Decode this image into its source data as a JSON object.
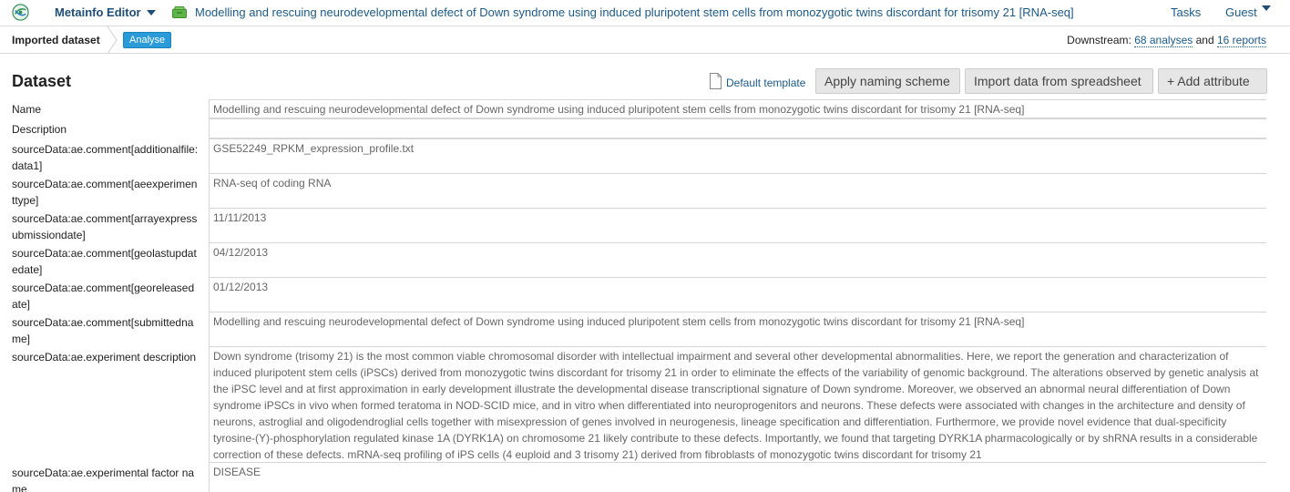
{
  "topbar": {
    "app_title": "Metainfo Editor",
    "dataset_title": "Modelling and rescuing neurodevelopmental defect of Down syndrome using induced pluripotent stem cells from monozygotic twins discordant for trisomy 21 [RNA-seq]",
    "tasks_label": "Tasks",
    "user_label": "Guest"
  },
  "subbar": {
    "breadcrumb": "Imported dataset",
    "analyse_label": "Analyse",
    "downstream_prefix": "Downstream:",
    "analyses_link": "68 analyses",
    "and_text": "and",
    "reports_link": "16 reports"
  },
  "main": {
    "heading": "Dataset",
    "default_template_label": "Default template",
    "apply_naming_label": "Apply naming scheme",
    "import_spreadsheet_label": "Import data from spreadsheet",
    "add_attribute_label": "+ Add attribute"
  },
  "attributes": [
    {
      "label": "Name",
      "value": "Modelling and rescuing neurodevelopmental defect of Down syndrome using induced pluripotent stem cells from monozygotic twins discordant for trisomy 21 [RNA-seq]"
    },
    {
      "label": "Description",
      "value": ""
    },
    {
      "label": "sourceData:ae.comment[additionalfile:data1]",
      "value": "GSE52249_RPKM_expression_profile.txt"
    },
    {
      "label": "sourceData:ae.comment[aeexperimenttype]",
      "value": "RNA-seq of coding RNA"
    },
    {
      "label": "sourceData:ae.comment[arrayexpressubmissiondate]",
      "value": "11/11/2013"
    },
    {
      "label": "sourceData:ae.comment[geolastupdatedate]",
      "value": "04/12/2013"
    },
    {
      "label": "sourceData:ae.comment[georeleasedate]",
      "value": "01/12/2013"
    },
    {
      "label": "sourceData:ae.comment[submittedname]",
      "value": "Modelling and rescuing neurodevelopmental defect of Down syndrome using induced pluripotent stem cells from monozygotic twins discordant for trisomy 21 [RNA-seq]"
    },
    {
      "label": "sourceData:ae.experiment description",
      "value": "Down syndrome (trisomy 21) is the most common viable chromosomal disorder with intellectual impairment and several other developmental abnormalities. Here, we report the generation and characterization of induced pluripotent stem cells (iPSCs) derived from monozygotic twins discordant for trisomy 21 in order to eliminate the effects of the variability of genomic background. The alterations observed by genetic analysis at the iPSC level and at first approximation in early development illustrate the developmental disease transcriptional signature of Down syndrome. Moreover, we observed an abnormal neural differentiation of Down syndrome iPSCs in vivo when formed teratoma in NOD-SCID mice, and in vitro when differentiated into neuroprogenitors and neurons. These defects were associated with changes in the architecture and density of neurons, astroglial and oligodendroglial cells together with misexpression of genes involved in neurogenesis, lineage specification and differentiation. Furthermore, we provide novel evidence that dual-specificity tyrosine-(Y)-phosphorylation regulated kinase 1A (DYRK1A) on chromosome 21 likely contribute to these defects. Importantly, we found that targeting DYRK1A pharmacologically or by shRNA results in a considerable correction of these defects. mRNA-seq profiling of iPS cells (4 euploid and 3 trisomy 21) derived from fibroblasts of monozygotic twins discordant for trisomy 21"
    },
    {
      "label": "sourceData:ae.experimental factor name",
      "value": "DISEASE"
    }
  ]
}
